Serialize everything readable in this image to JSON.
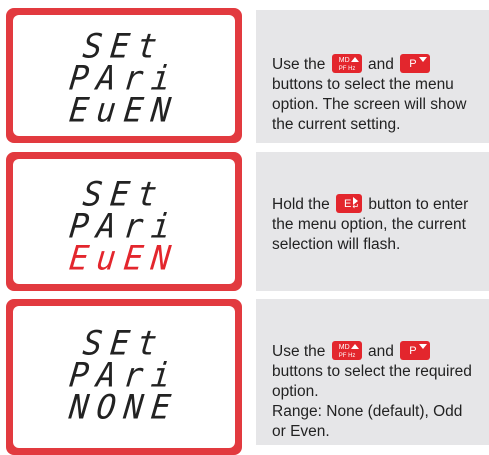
{
  "steps": [
    {
      "display": {
        "line1": "SEt",
        "line2": "PAri",
        "line3": "EuEN",
        "line3_flashing": false
      },
      "instruction": {
        "part1": "Use the",
        "part2": "and",
        "part3": "buttons to select the menu option. The screen will show the current setting."
      },
      "buttons": [
        {
          "icon": "md-pf-up-button-icon",
          "label_top": "MD",
          "label_bottom": "PF Hz"
        },
        {
          "icon": "p-down-button-icon",
          "label": "P"
        }
      ]
    },
    {
      "display": {
        "line1": "SEt",
        "line2": "PAri",
        "line3": "EuEN",
        "line3_flashing": true
      },
      "instruction": {
        "part1": "Hold the",
        "part2": "button to enter the menu option, the current selection will flash."
      },
      "buttons": [
        {
          "icon": "e-enter-button-icon",
          "label": "E"
        }
      ]
    },
    {
      "display": {
        "line1": "SEt",
        "line2": "PAri",
        "line3": "NONE",
        "line3_flashing": false
      },
      "instruction": {
        "part1": "Use the",
        "part2": "and",
        "part3": "buttons to select the required option.",
        "part4": "Range: None (default), Odd or Even."
      },
      "buttons": [
        {
          "icon": "md-pf-up-button-icon",
          "label_top": "MD",
          "label_bottom": "PF Hz"
        },
        {
          "icon": "p-down-button-icon",
          "label": "P"
        }
      ]
    }
  ],
  "colors": {
    "accent": "#e3262d",
    "panel": "#e6e6e8",
    "lcd_text": "#222222"
  }
}
